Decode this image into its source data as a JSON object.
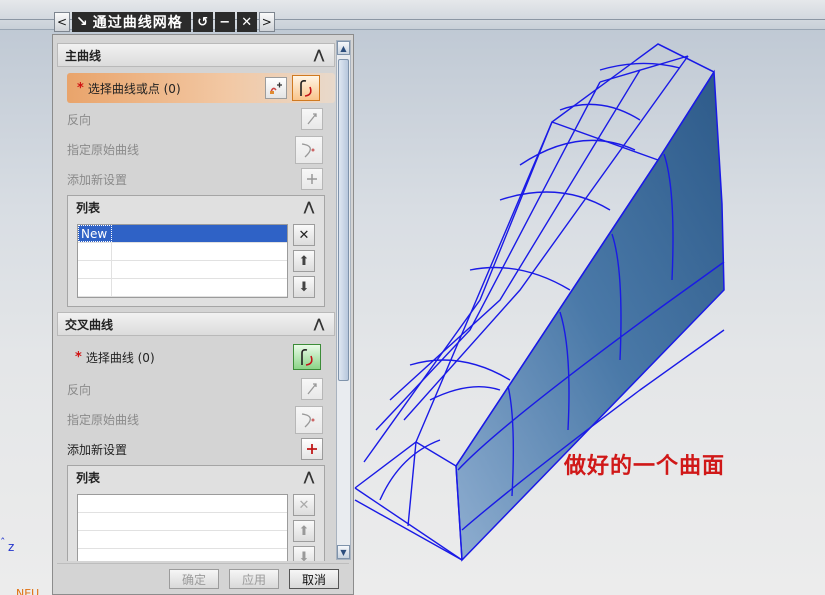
{
  "dialog": {
    "title": "通过曲线网格",
    "titlebar_buttons": [
      "<",
      ">"
    ],
    "sections": {
      "primary": {
        "header": "主曲线",
        "select_label": "选择曲线或点 (0)",
        "reverse": "反向",
        "specify_origin": "指定原始曲线",
        "add_new": "添加新设置",
        "list_header": "列表",
        "list_items": [
          "New"
        ]
      },
      "cross": {
        "header": "交叉曲线",
        "select_label": "选择曲线 (0)",
        "reverse": "反向",
        "specify_origin": "指定原始曲线",
        "add_new": "添加新设置",
        "list_header": "列表"
      }
    },
    "footer": {
      "ok": "确定",
      "apply": "应用",
      "cancel": "取消"
    }
  },
  "viewport": {
    "annotation": "做好的一个曲面",
    "axis_label": "z",
    "corner_text": "NEU"
  },
  "colors": {
    "highlight": "#e9a46b",
    "wire": "#1a1ae6",
    "surface": "#4a79a8",
    "annotation": "#d01818"
  },
  "icons": [
    "back-icon",
    "forward-icon",
    "curve-select-icon",
    "point-constructor-icon",
    "reverse-icon",
    "origin-curve-icon",
    "add-set-icon",
    "delete-icon",
    "move-up-icon",
    "move-down-icon"
  ]
}
